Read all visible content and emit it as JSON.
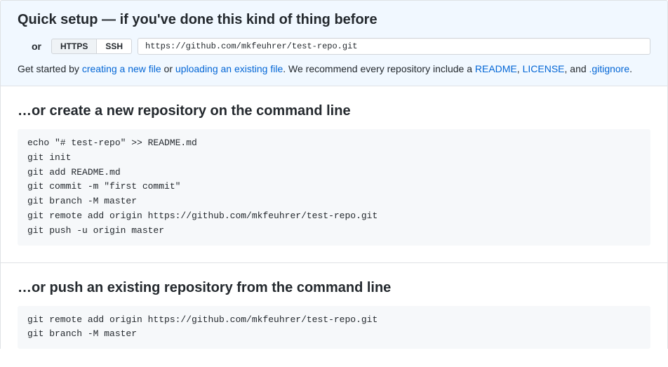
{
  "quick_setup": {
    "title": "Quick setup — if you've done this kind of thing before",
    "or_label": "or",
    "https_label": "HTTPS",
    "ssh_label": "SSH",
    "url": "https://github.com/mkfeuhrer/test-repo.git",
    "helper_prefix": "Get started by ",
    "link_create": "creating a new file",
    "helper_or": " or ",
    "link_upload": "uploading an existing file",
    "helper_mid": ". We recommend every repository include a ",
    "link_readme": "README",
    "comma1": ", ",
    "link_license": "LICENSE",
    "helper_and": ", and ",
    "link_gitignore": ".gitignore",
    "period": "."
  },
  "create_section": {
    "title": "…or create a new repository on the command line",
    "code": "echo \"# test-repo\" >> README.md\ngit init\ngit add README.md\ngit commit -m \"first commit\"\ngit branch -M master\ngit remote add origin https://github.com/mkfeuhrer/test-repo.git\ngit push -u origin master"
  },
  "push_section": {
    "title": "…or push an existing repository from the command line",
    "code": "git remote add origin https://github.com/mkfeuhrer/test-repo.git\ngit branch -M master"
  }
}
